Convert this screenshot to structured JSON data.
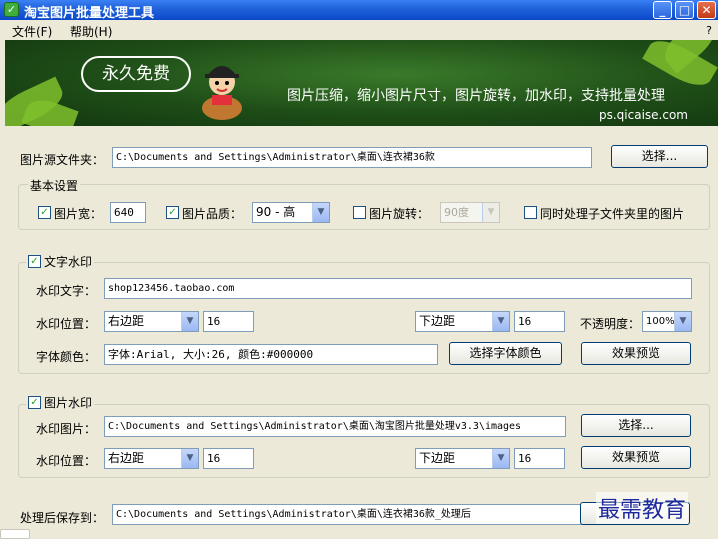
{
  "window": {
    "title": "淘宝图片批量处理工具",
    "min": "_",
    "max": "□",
    "close": "✕"
  },
  "menu": {
    "file": "文件(F)",
    "help": "帮助(H)",
    "question": "?"
  },
  "banner": {
    "badge": "永久免费",
    "slogan": "图片压缩，缩小图片尺寸，图片旋转，加水印，支持批量处理",
    "site": "ps.qicaise.com"
  },
  "source": {
    "label": "图片源文件夹：",
    "path": "C:\\Documents and Settings\\Administrator\\桌面\\连衣裙36款",
    "browse": "选择..."
  },
  "basic": {
    "title": "基本设置",
    "width_label": "图片宽：",
    "width_value": "640",
    "width_checked": true,
    "quality_label": "图片品质：",
    "quality_value": "90 - 高",
    "quality_checked": true,
    "rotate_label": "图片旋转：",
    "rotate_value": "90度",
    "rotate_checked": false,
    "subfolders_label": "同时处理子文件夹里的图片",
    "subfolders_checked": false
  },
  "text_wm": {
    "title": "文字水印",
    "checked": true,
    "text_label": "水印文字：",
    "text_value": "shop123456.taobao.com",
    "pos_label": "水印位置：",
    "h_pos": "右边距",
    "h_value": "16",
    "v_pos": "下边距",
    "v_value": "16",
    "opacity_label": "不透明度：",
    "opacity_value": "100%",
    "color_label": "字体颜色：",
    "font_value": "字体:Arial, 大小:26, 颜色:#000000",
    "font_button": "选择字体颜色",
    "preview_button": "效果预览"
  },
  "image_wm": {
    "title": "图片水印",
    "checked": true,
    "image_label": "水印图片：",
    "image_path": "C:\\Documents and Settings\\Administrator\\桌面\\淘宝图片批量处理v3.3\\images",
    "browse": "选择...",
    "pos_label": "水印位置：",
    "h_pos": "右边距",
    "h_value": "16",
    "v_pos": "下边距",
    "v_value": "16",
    "preview_button": "效果预览"
  },
  "output": {
    "label": "处理后保存到：",
    "path": "C:\\Documents and Settings\\Administrator\\桌面\\连衣裙36款_处理后"
  },
  "watermark_text": "最需教育",
  "icons": {
    "check": "✓",
    "dropdown": "▼"
  }
}
